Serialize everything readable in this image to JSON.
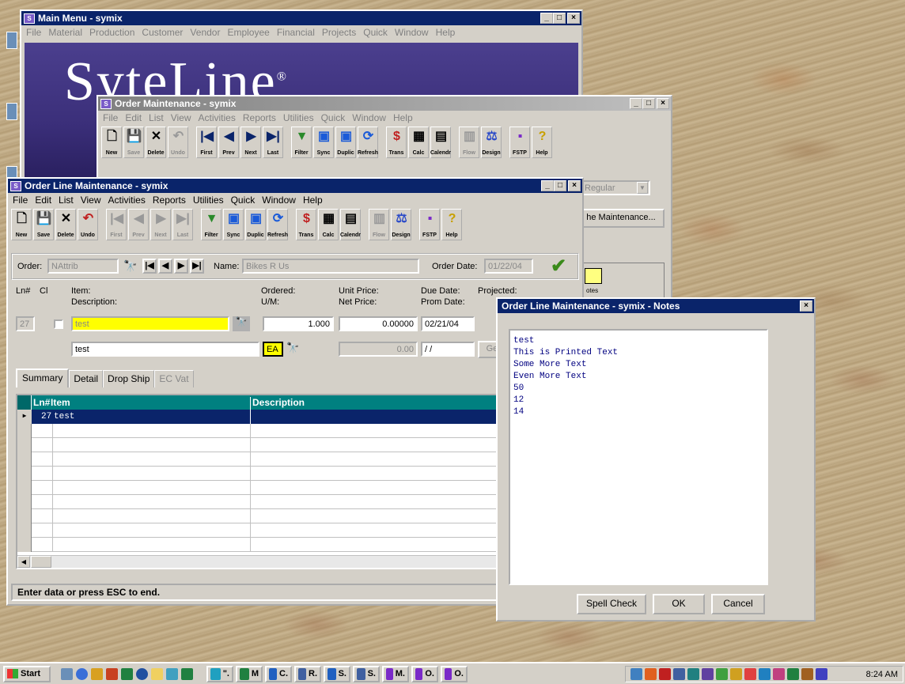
{
  "main_menu": {
    "title": "Main Menu - symix",
    "menu": [
      "File",
      "Material",
      "Production",
      "Customer",
      "Vendor",
      "Employee",
      "Financial",
      "Projects",
      "Quick",
      "Window",
      "Help"
    ],
    "logo_text": "SyteLine",
    "logo_reg": "®"
  },
  "order_maint": {
    "title": "Order Maintenance - symix",
    "menu": [
      "File",
      "Edit",
      "List",
      "View",
      "Activities",
      "Reports",
      "Utilities",
      "Quick",
      "Window",
      "Help"
    ],
    "toolbar": [
      "New",
      "Save",
      "Delete",
      "Undo",
      "First",
      "Prev",
      "Next",
      "Last",
      "Filter",
      "Sync",
      "Duplic",
      "Refresh",
      "Trans",
      "Calc",
      "Calendr",
      "Flow",
      "Design",
      "FSTP",
      "Help"
    ],
    "regular_value": "Regular",
    "line_maint_button": "he Maintenance...",
    "notes_label": "otes"
  },
  "olm": {
    "title": "Order Line Maintenance - symix",
    "menu": [
      "File",
      "Edit",
      "List",
      "View",
      "Activities",
      "Reports",
      "Utilities",
      "Quick",
      "Window",
      "Help"
    ],
    "toolbar": [
      "New",
      "Save",
      "Delete",
      "Undo",
      "First",
      "Prev",
      "Next",
      "Last",
      "Filter",
      "Sync",
      "Duplic",
      "Refresh",
      "Trans",
      "Calc",
      "Calendr",
      "Flow",
      "Design",
      "FSTP",
      "Help"
    ],
    "order_label": "Order:",
    "order_value": "NAttrib",
    "name_label": "Name:",
    "name_value": "Bikes R Us",
    "order_date_label": "Order Date:",
    "order_date_value": "01/22/04",
    "headers": {
      "ln": "Ln#",
      "cl": "Cl",
      "item": "Item:",
      "description": "Description:",
      "ordered": "Ordered:",
      "um": "U/M:",
      "unit_price": "Unit Price:",
      "net_price": "Net Price:",
      "due_date": "Due Date:",
      "prom_date": "Prom Date:",
      "projected": "Projected:"
    },
    "line_no": "27",
    "item_value": "test",
    "description_value": "test",
    "ordered_value": "1.000",
    "unit_price_value": "0.00000",
    "due_date_value": "02/21/04",
    "um_value": "EA",
    "net_price_value": "0.00",
    "prom_date_value": " / /",
    "ge_button": "Ge",
    "tabs": [
      "Summary",
      "Detail",
      "Drop Ship",
      "EC Vat"
    ],
    "grid_columns": [
      "Ln#",
      "Item",
      "Description"
    ],
    "grid_rows": [
      {
        "ln": "27",
        "item": "test",
        "description": ""
      }
    ],
    "status": "Enter data or press ESC to end."
  },
  "notes": {
    "title": "Order Line Maintenance - symix - Notes",
    "lines": [
      "test",
      "This is Printed Text",
      "Some More Text",
      "Even More Text",
      "50",
      "12",
      "14"
    ],
    "spell_check": "Spell Check",
    "ok": "OK",
    "cancel": "Cancel"
  },
  "taskbar": {
    "start": "Start",
    "tasks": [
      "\".",
      "M",
      "C.",
      "R.",
      "S.",
      "S.",
      "M.",
      "O.",
      "O."
    ],
    "clock": "8:24 AM"
  }
}
